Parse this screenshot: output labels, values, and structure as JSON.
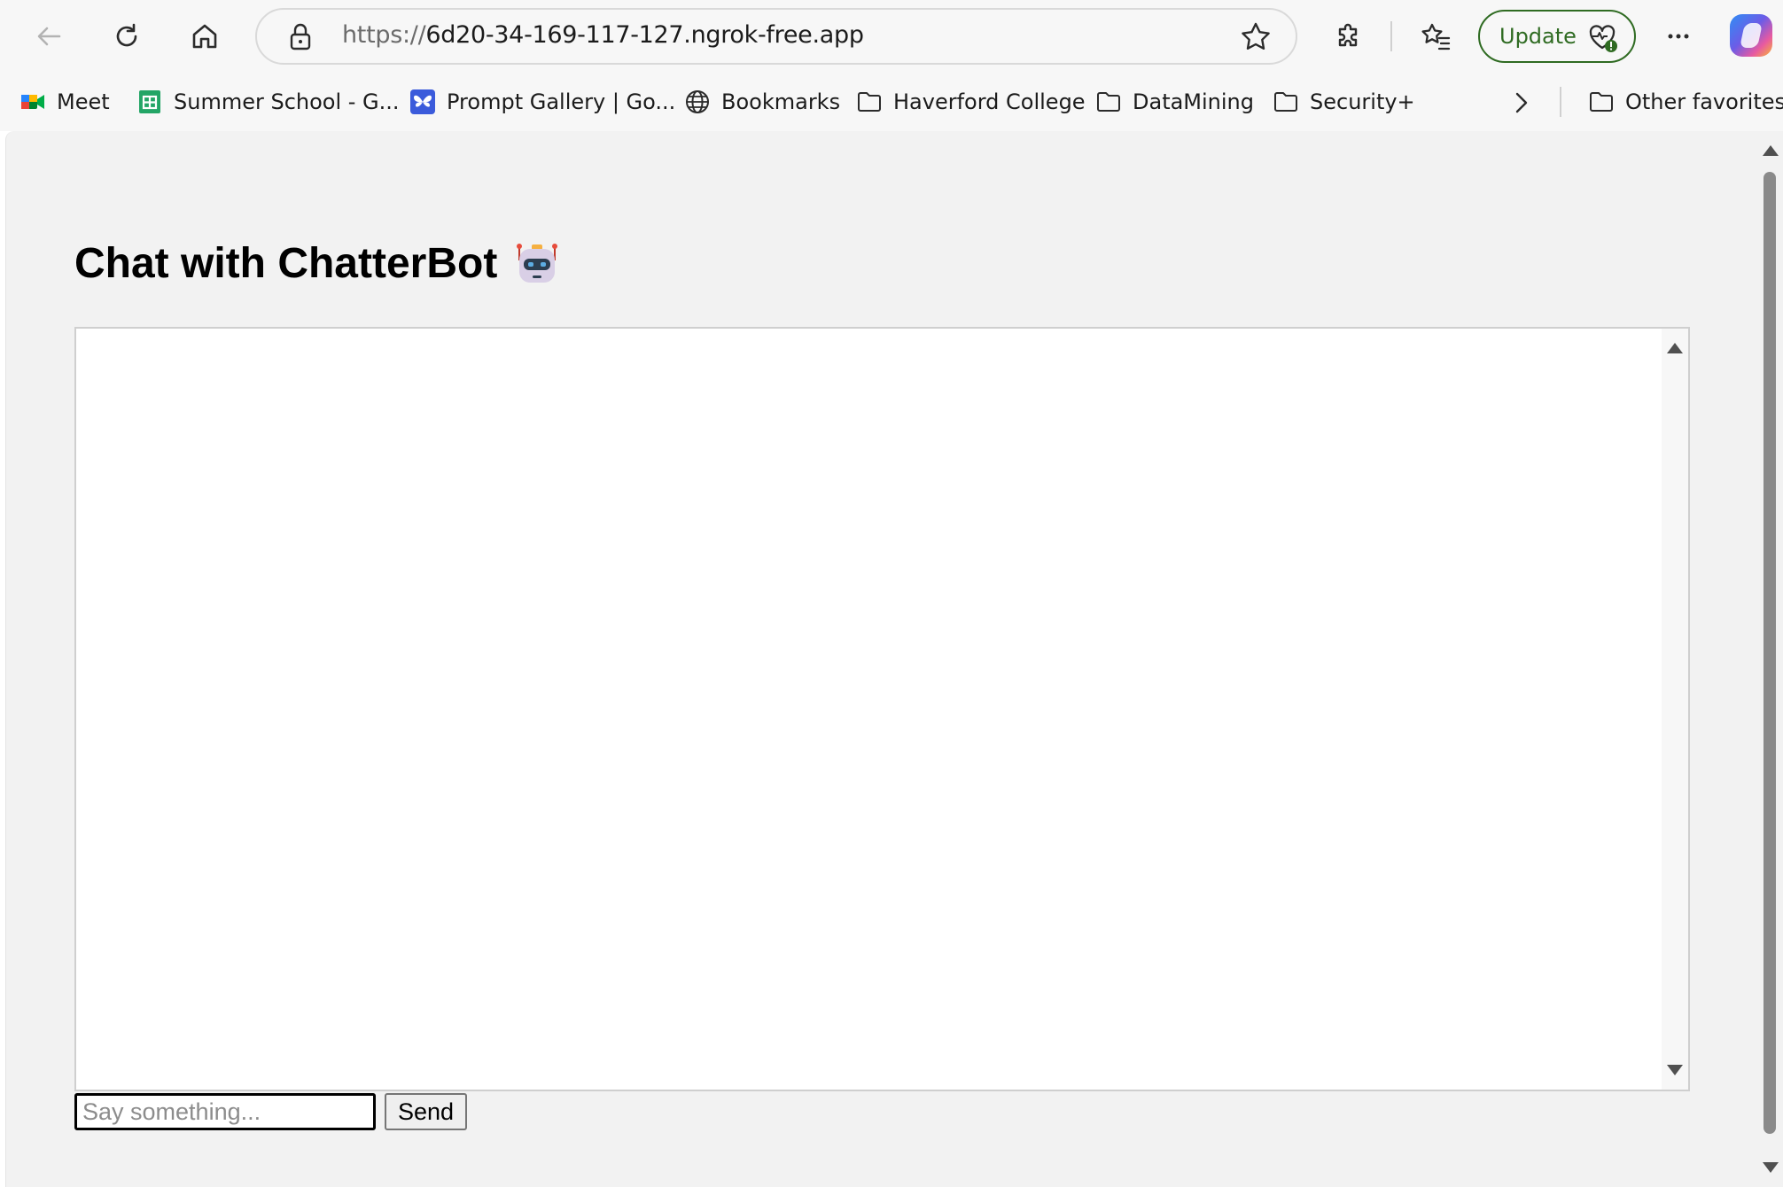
{
  "browser": {
    "address_bar": {
      "url_scheme": "https://",
      "url_host": "6d20-34-169-117-127.ngrok-free.app"
    },
    "update_label": "Update",
    "icons": [
      "back-icon",
      "refresh-icon",
      "home-icon",
      "lock-icon",
      "star-icon",
      "extensions-icon",
      "favorites-icon",
      "heart-pulse-icon",
      "more-icon",
      "copilot-icon"
    ]
  },
  "favorites": {
    "items": [
      {
        "label": "Meet",
        "icon": "meet-icon"
      },
      {
        "label": "Summer School - G...",
        "icon": "sheets-icon"
      },
      {
        "label": "Prompt Gallery | Go...",
        "icon": "butterfly-icon"
      },
      {
        "label": "Bookmarks",
        "icon": "globe-icon"
      },
      {
        "label": "Haverford College",
        "icon": "folder-icon"
      },
      {
        "label": "DataMining",
        "icon": "folder-icon"
      },
      {
        "label": "Security+",
        "icon": "folder-icon"
      }
    ],
    "other_label": "Other favorites"
  },
  "page": {
    "title": "Chat with ChatterBot",
    "title_emoji": "robot-icon",
    "input_placeholder": "Say something...",
    "input_value": "",
    "send_label": "Send"
  },
  "colors": {
    "update_green": "#2f6b22",
    "page_bg": "#f2f2f2",
    "chat_bg": "#ffffff"
  }
}
